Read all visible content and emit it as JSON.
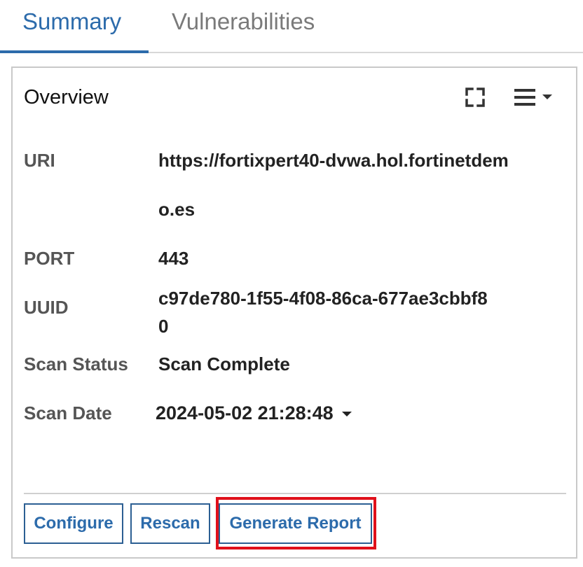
{
  "tabs": {
    "summary": "Summary",
    "vulnerabilities": "Vulnerabilities"
  },
  "panel": {
    "title": "Overview",
    "icons": [
      "fullscreen-icon",
      "menu-icon",
      "caret-down-icon"
    ]
  },
  "fields": {
    "uri_label": "URI",
    "uri_line1": "https://fortixpert40-dvwa.hol.fortinetdem",
    "uri_line2": "o.es",
    "port_label": "PORT",
    "port_value": "443",
    "uuid_label": "UUID",
    "uuid_line1": "c97de780-1f55-4f08-86ca-677ae3cbbf8",
    "uuid_line2": "0",
    "status_label": "Scan Status",
    "status_value": "Scan Complete",
    "date_label": "Scan Date",
    "date_value": "2024-05-02 21:28:48"
  },
  "buttons": {
    "configure": "Configure",
    "rescan": "Rescan",
    "generate_report": "Generate Report"
  },
  "colors": {
    "accent": "#2c6bab",
    "highlight": "#e0101b"
  }
}
